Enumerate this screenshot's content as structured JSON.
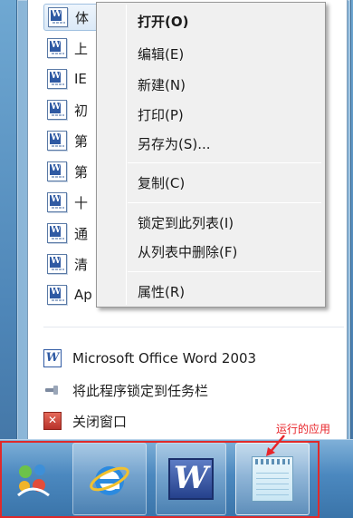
{
  "recent_items": [
    {
      "label": "体",
      "selected": true
    },
    {
      "label": "上",
      "selected": false
    },
    {
      "label": "IE",
      "selected": false
    },
    {
      "label": "初",
      "selected": false
    },
    {
      "label": "第",
      "selected": false
    },
    {
      "label": "第",
      "selected": false
    },
    {
      "label": "十",
      "selected": false
    },
    {
      "label": "通",
      "selected": false
    },
    {
      "label": "清",
      "selected": false
    },
    {
      "label": "Ap",
      "selected": false
    }
  ],
  "word_icon_letter": "W",
  "context_menu": {
    "open": "打开(O)",
    "edit": "编辑(E)",
    "new": "新建(N)",
    "print": "打印(P)",
    "save_as": "另存为(S)...",
    "copy": "复制(C)",
    "pin": "锁定到此列表(I)",
    "remove": "从列表中删除(F)",
    "properties": "属性(R)"
  },
  "tasks": {
    "app_name": "Microsoft Office Word 2003",
    "pin_taskbar": "将此程序锁定到任务栏",
    "close_window": "关闭窗口"
  },
  "annotation": {
    "text": "运行的应用",
    "color": "#e8242a"
  },
  "taskbar": {
    "buttons": [
      "start-orb",
      "internet-explorer",
      "microsoft-word",
      "notepad"
    ],
    "highlight_color": "#e02a2a"
  }
}
